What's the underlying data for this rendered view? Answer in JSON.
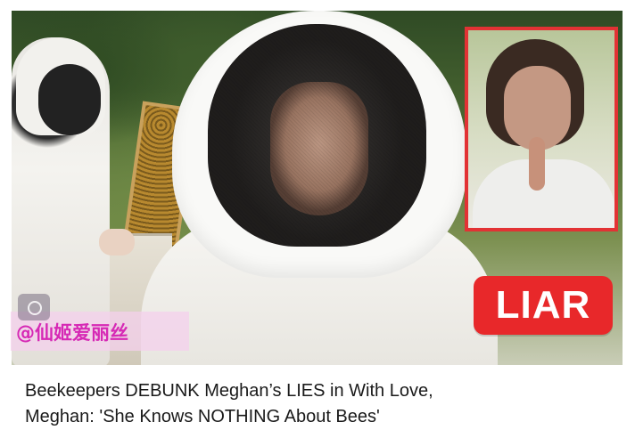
{
  "thumbnail": {
    "badge_text": "LIAR",
    "badge_color": "#e8282a",
    "inset_border_color": "#e23234",
    "watermark": "@仙姬爱丽丝",
    "watermark_color": "#d629b5",
    "watermark_icon": "camera-icon"
  },
  "headline": {
    "line1": "Beekeepers DEBUNK Meghan’s LIES in With Love,",
    "line2": "Meghan: 'She Knows NOTHING About Bees'"
  }
}
